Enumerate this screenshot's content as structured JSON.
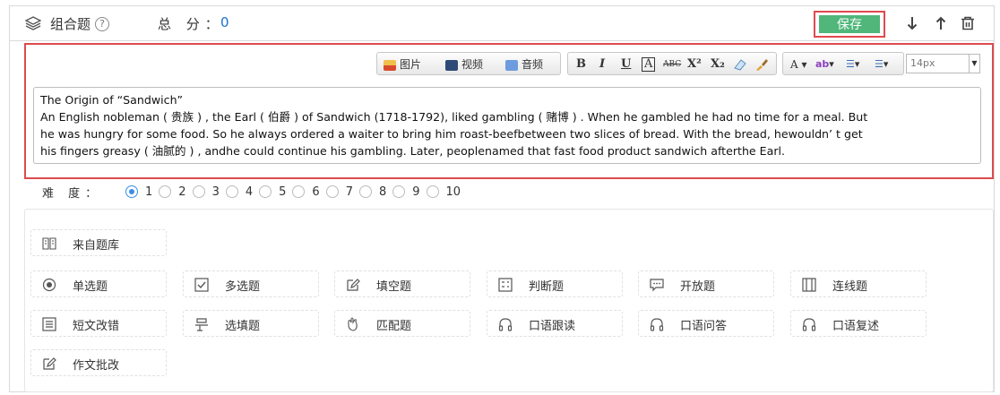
{
  "header": {
    "title": "组合题",
    "help_mark": "?",
    "score_label": "总 分：",
    "score_value": "0",
    "save_label": "保存"
  },
  "toolbar": {
    "image_label": "图片",
    "video_label": "视频",
    "audio_label": "音频",
    "bold": "B",
    "italic": "I",
    "underline": "U",
    "boxed": "A",
    "strike": "ABC",
    "superscript": "X²",
    "subscript": "X₂",
    "font_color": "A ▾",
    "highlight": "▾",
    "ordered_list": "▾",
    "unordered_list": "▾",
    "font_size": "14px"
  },
  "editor": {
    "lines": [
      "The Origin of  “Sandwich”",
      "An English nobleman ( 贵族 ) , the Earl ( 伯爵 ) of Sandwich (1718-1792), liked gambling ( 赌博 ) . When he gambled he had no time for a meal. But",
      "he was hungry for some food. So he always ordered a waiter to bring him roast-beefbetween two slices of bread. With the bread, hewouldn’ t get",
      "his fingers greasy ( 油腻的 ) , andhe could continue his gambling. Later, peoplenamed that fast food product sandwich afterthe Earl."
    ]
  },
  "difficulty": {
    "label": "难 度：",
    "options": [
      "1",
      "2",
      "3",
      "4",
      "5",
      "6",
      "7",
      "8",
      "9",
      "10"
    ],
    "selected": "1"
  },
  "question_types": {
    "bank": "来自题库",
    "row1": [
      "单选题",
      "多选题",
      "填空题",
      "判断题",
      "开放题",
      "连线题"
    ],
    "row2": [
      "短文改错",
      "选填题",
      "匹配题",
      "口语跟读",
      "口语问答",
      "口语复述"
    ],
    "row3": [
      "作文批改"
    ]
  },
  "colors": {
    "accent_blue": "#1d6fd0",
    "save_green": "#50b67a",
    "highlight_red": "#dc4b4d"
  }
}
